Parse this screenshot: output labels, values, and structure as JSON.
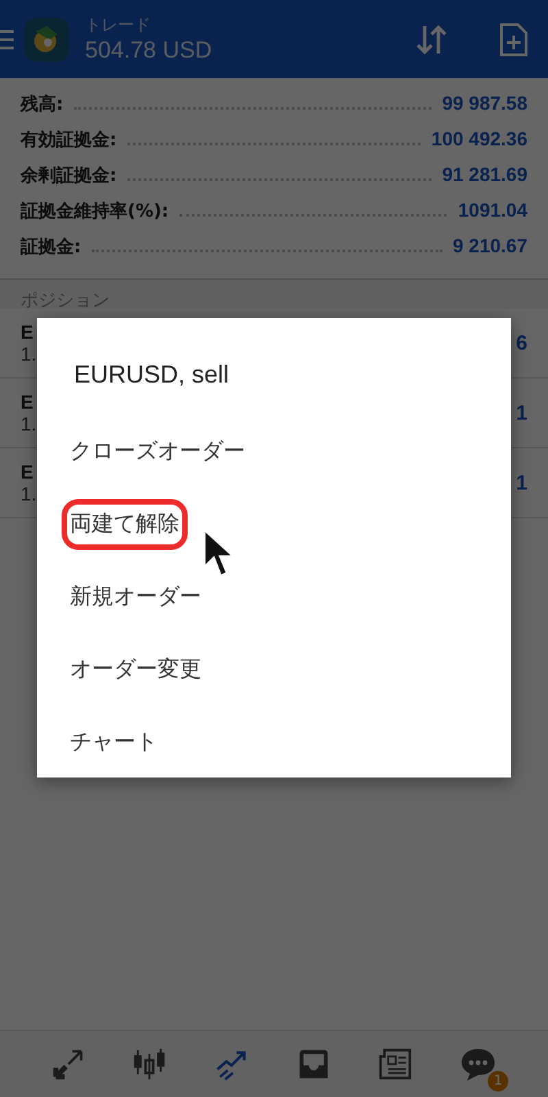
{
  "header": {
    "title": "トレード",
    "balance": "504.78 USD"
  },
  "account": [
    {
      "label": "残高:",
      "value": "99 987.58"
    },
    {
      "label": "有効証拠金:",
      "value": "100 492.36"
    },
    {
      "label": "余剰証拠金:",
      "value": "91 281.69"
    },
    {
      "label": "証拠金維持率(%):",
      "value": "1091.04"
    },
    {
      "label": "証拠金:",
      "value": "9 210.67"
    }
  ],
  "positions_heading": "ポジション",
  "positions": [
    {
      "symbol": "E",
      "price": "1.",
      "profit": "6"
    },
    {
      "symbol": "E",
      "price": "1.",
      "profit": "1"
    },
    {
      "symbol": "E",
      "price": "1.",
      "profit": "1"
    }
  ],
  "dialog": {
    "title": "EURUSD, sell",
    "items": [
      {
        "label": "クローズオーダー",
        "highlighted": false
      },
      {
        "label": "両建て解除",
        "highlighted": true
      },
      {
        "label": "新規オーダー",
        "highlighted": false
      },
      {
        "label": "オーダー変更",
        "highlighted": false
      },
      {
        "label": "チャート",
        "highlighted": false
      }
    ]
  },
  "nav": [
    {
      "kind": "quotes",
      "selected": false
    },
    {
      "kind": "chart",
      "selected": false
    },
    {
      "kind": "trade",
      "selected": true
    },
    {
      "kind": "history",
      "selected": false
    },
    {
      "kind": "news",
      "selected": false
    },
    {
      "kind": "chat",
      "selected": false,
      "badge": "1"
    }
  ]
}
